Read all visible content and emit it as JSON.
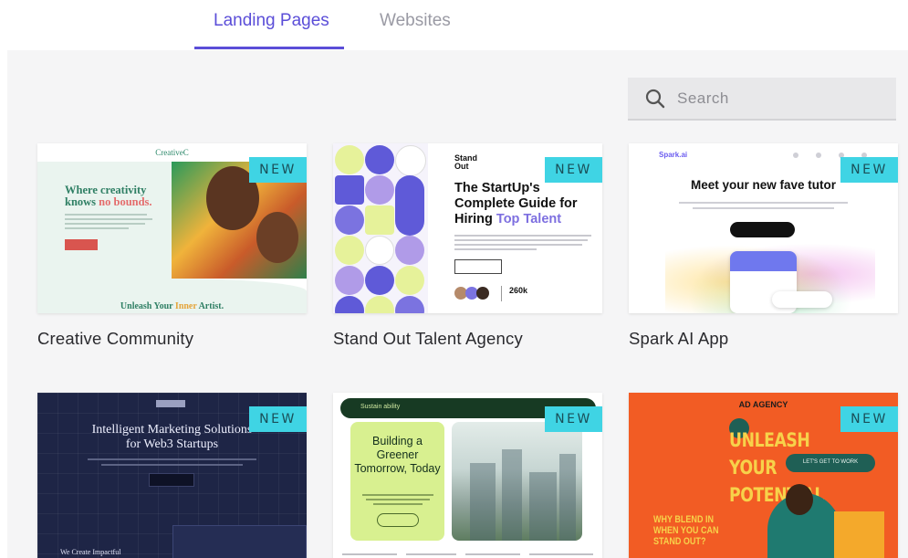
{
  "tabs": [
    {
      "label": "Landing Pages",
      "active": true
    },
    {
      "label": "Websites",
      "active": false
    }
  ],
  "search": {
    "placeholder": "Search"
  },
  "badge_label": "NEW",
  "colors": {
    "accent": "#5b4ed8",
    "badge": "#3fd4e4",
    "panel": "#f5f5f6"
  },
  "cards": [
    {
      "title": "Creative Community",
      "preview": {
        "brand": "CreativeC",
        "headline_1": "Where creativity",
        "headline_2a": "knows ",
        "headline_2b": "no bounds.",
        "footer_a": "Unleash Your ",
        "footer_b": "Inner",
        "footer_c": " Artist."
      }
    },
    {
      "title": "Stand Out Talent Agency",
      "preview": {
        "logo_1": "Stand",
        "logo_2": "Out",
        "headline_a": "The StartUp's Complete Guide for Hiring ",
        "headline_b": "Top Talent",
        "stat": "260k"
      }
    },
    {
      "title": "Spark AI App",
      "preview": {
        "logo": "Spark.ai",
        "headline": "Meet your new fave tutor"
      }
    },
    {
      "title": "",
      "preview": {
        "headline_1": "Intelligent Marketing Solutions",
        "headline_2": "for Web3 Startups",
        "subline": "We Create Impactful"
      }
    },
    {
      "title": "",
      "preview": {
        "bar_label": "Sustain ability",
        "headline": "Building a Greener Tomorrow, Today"
      }
    },
    {
      "title": "",
      "preview": {
        "logo": "AD AGENCY",
        "headline_1": "UNLEASH",
        "headline_2": "YOUR",
        "headline_3": "POTENTIAL",
        "button": "LET'S GET TO WORK",
        "sub_1": "WHY BLEND IN",
        "sub_2": "WHEN YOU CAN",
        "sub_3": "STAND OUT?"
      }
    }
  ]
}
